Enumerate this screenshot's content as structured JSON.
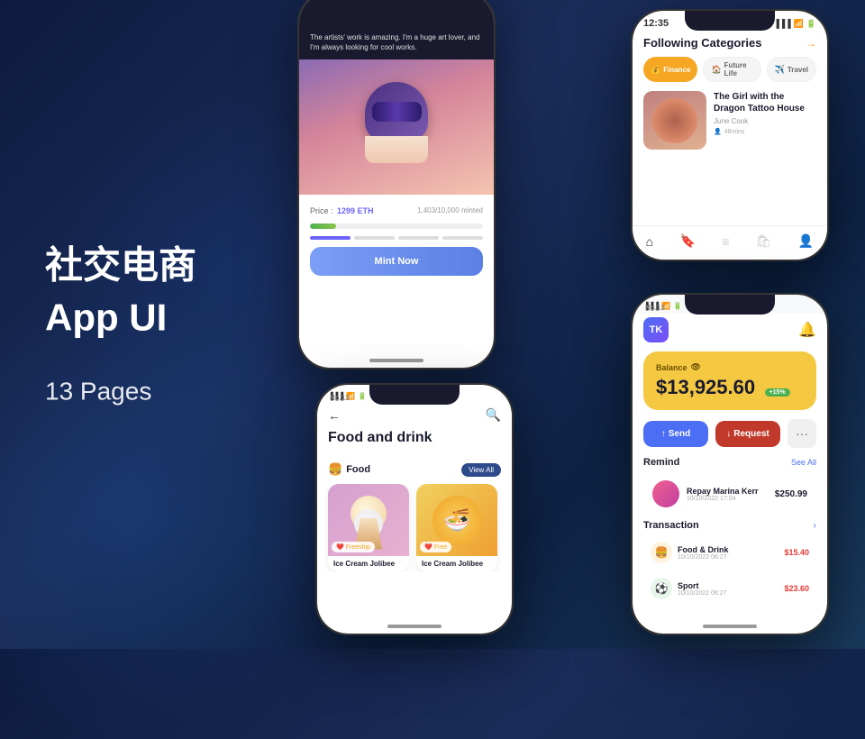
{
  "background": {
    "gradient": "linear-gradient(135deg, #0d1b3e 0%, #1a2d5a 40%, #0d2244 70%, #1a3a5c 100%)"
  },
  "left_panel": {
    "title_cn": "社交电商",
    "title_en": "App UI",
    "subtitle": "13 Pages"
  },
  "phone_nft": {
    "header_text": "The artists' work is amazing. I'm a huge art lover, and I'm always looking for cool works.",
    "price_label": "Price :",
    "price_value": "1299 ETH",
    "minted_label": "1,403/10,000 minted",
    "mint_button": "Mint Now"
  },
  "phone_news": {
    "time": "12:35",
    "following_label": "Following Categories",
    "categories": [
      {
        "name": "Finance",
        "active": true,
        "icon": "💰"
      },
      {
        "name": "Future Life",
        "active": false,
        "icon": "🏠"
      },
      {
        "name": "Travel",
        "active": false,
        "icon": "✈️"
      }
    ],
    "article_title": "The Girl with the Dragon Tattoo House",
    "article_author": "June Cook",
    "article_meta": "48mins"
  },
  "phone_food": {
    "device_label": "No.13",
    "title": "Food and drink",
    "category_label": "Food",
    "view_all": "View All",
    "items": [
      {
        "name": "Ice Cream Jolibee",
        "badge": "Freeship"
      },
      {
        "name": "Ice Cream Jolibee",
        "badge": "Free"
      }
    ]
  },
  "phone_finance": {
    "device_label": "No.13",
    "logo": "TK",
    "balance_label": "Balance",
    "balance_amount": "$13,925.60",
    "balance_badge": "+15%",
    "send_label": "Send",
    "request_label": "Request",
    "remind_title": "Remind",
    "see_all": "See All",
    "remind_name": "Repay Marina Kerr",
    "remind_date": "10/10/2022 17:04",
    "remind_amount": "$250.99",
    "transaction_title": "Transaction",
    "transactions": [
      {
        "name": "Food & Drink",
        "date": "10/10/2022 06:27",
        "amount": "$15.40",
        "icon": "🍔"
      },
      {
        "name": "Sport",
        "date": "10/10/2022 06:27",
        "amount": "$23.60",
        "icon": "⚽"
      }
    ]
  }
}
